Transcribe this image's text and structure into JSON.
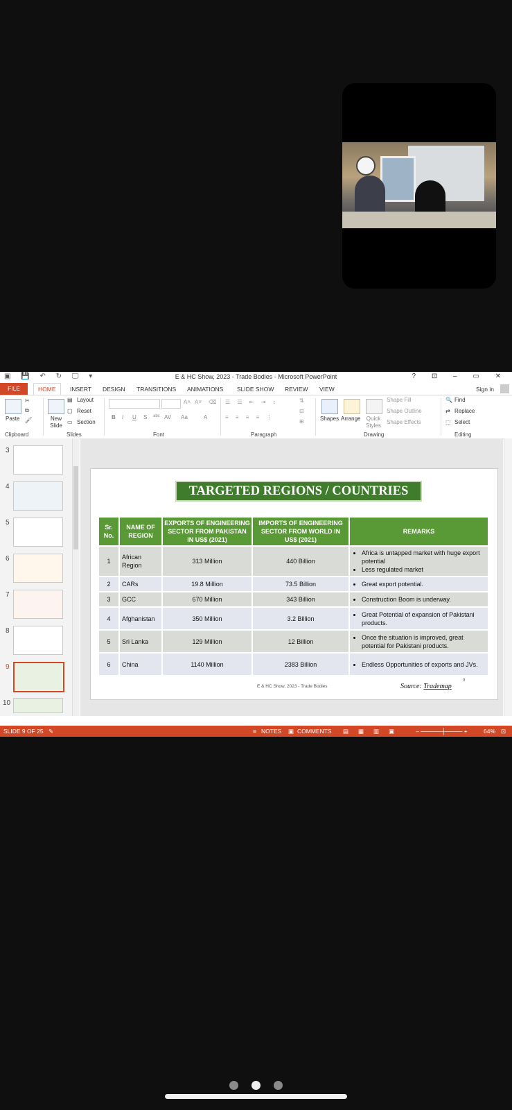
{
  "window": {
    "title": "E & HC Show, 2023 - Trade Bodies - Microsoft PowerPoint",
    "help": "?",
    "controls": [
      "⊡",
      "–",
      "🗗",
      "✕"
    ]
  },
  "ribbon_tabs": [
    "FILE",
    "HOME",
    "INSERT",
    "DESIGN",
    "TRANSITIONS",
    "ANIMATIONS",
    "SLIDE SHOW",
    "REVIEW",
    "VIEW"
  ],
  "sign_in": "Sign in",
  "ribbon": {
    "clipboard": {
      "label": "Clipboard",
      "paste": "Paste"
    },
    "slides": {
      "label": "Slides",
      "new_slide": "New Slide",
      "layout": "Layout",
      "reset": "Reset",
      "section": "Section"
    },
    "font": {
      "label": "Font",
      "bold": "B",
      "italic": "I",
      "underline": "U",
      "strike": "S",
      "abc": "abc",
      "av": "AV",
      "aa": "Aa",
      "fontcolor": "A"
    },
    "paragraph": {
      "label": "Paragraph"
    },
    "drawing": {
      "label": "Drawing",
      "shapes": "Shapes",
      "arrange": "Arrange",
      "quick_styles": "Quick Styles",
      "shape_fill": "Shape Fill",
      "shape_outline": "Shape Outline",
      "shape_effects": "Shape Effects"
    },
    "editing": {
      "label": "Editing",
      "find": "Find",
      "replace": "Replace",
      "select": "Select"
    }
  },
  "thumbnails": [
    {
      "num": "3"
    },
    {
      "num": "4"
    },
    {
      "num": "5"
    },
    {
      "num": "6"
    },
    {
      "num": "7"
    },
    {
      "num": "8"
    },
    {
      "num": "9"
    },
    {
      "num": "10"
    }
  ],
  "slide": {
    "title": "TARGETED REGIONS / COUNTRIES",
    "headers": [
      "Sr. No.",
      "NAME OF REGION",
      "EXPORTS OF ENGINEERING SECTOR FROM PAKISTAN IN US$ (2021)",
      "IMPORTS OF ENGINEERING SECTOR FROM WORLD IN US$ (2021)",
      "REMARKS"
    ],
    "rows": [
      {
        "sr": "1",
        "region": "African Region",
        "exports": "313 Million",
        "imports": "440 Billion",
        "remarks": [
          "Africa is untapped market with huge export potential",
          "Less regulated market"
        ]
      },
      {
        "sr": "2",
        "region": "CARs",
        "exports": "19.8 Million",
        "imports": "73.5 Billion",
        "remarks": [
          "Great export potential."
        ]
      },
      {
        "sr": "3",
        "region": "GCC",
        "exports": "670 Million",
        "imports": "343 Billion",
        "remarks": [
          "Construction Boom is underway."
        ]
      },
      {
        "sr": "4",
        "region": "Afghanistan",
        "exports": "350 Million",
        "imports": "3.2 Billion",
        "remarks": [
          "Great Potential of expansion of Pakistani products."
        ]
      },
      {
        "sr": "5",
        "region": "Sri Lanka",
        "exports": "129 Million",
        "imports": "12 Billion",
        "remarks": [
          "Once the situation is improved, great potential for Pakistani products."
        ]
      },
      {
        "sr": "6",
        "region": "China",
        "exports": "1140 Million",
        "imports": "2383 Billion",
        "remarks": [
          "Endless Opportunities of exports and JVs."
        ]
      }
    ],
    "footer": "E & HC Show, 2023 - Trade Bodies",
    "source_prefix": "Source: ",
    "source_name": "Trademap",
    "page_number": "9"
  },
  "statusbar": {
    "slide_info": "SLIDE 9 OF 25",
    "notes": "NOTES",
    "comments": "COMMENTS",
    "zoom": "64%"
  },
  "pager": {
    "pages": 3,
    "active": 2
  }
}
